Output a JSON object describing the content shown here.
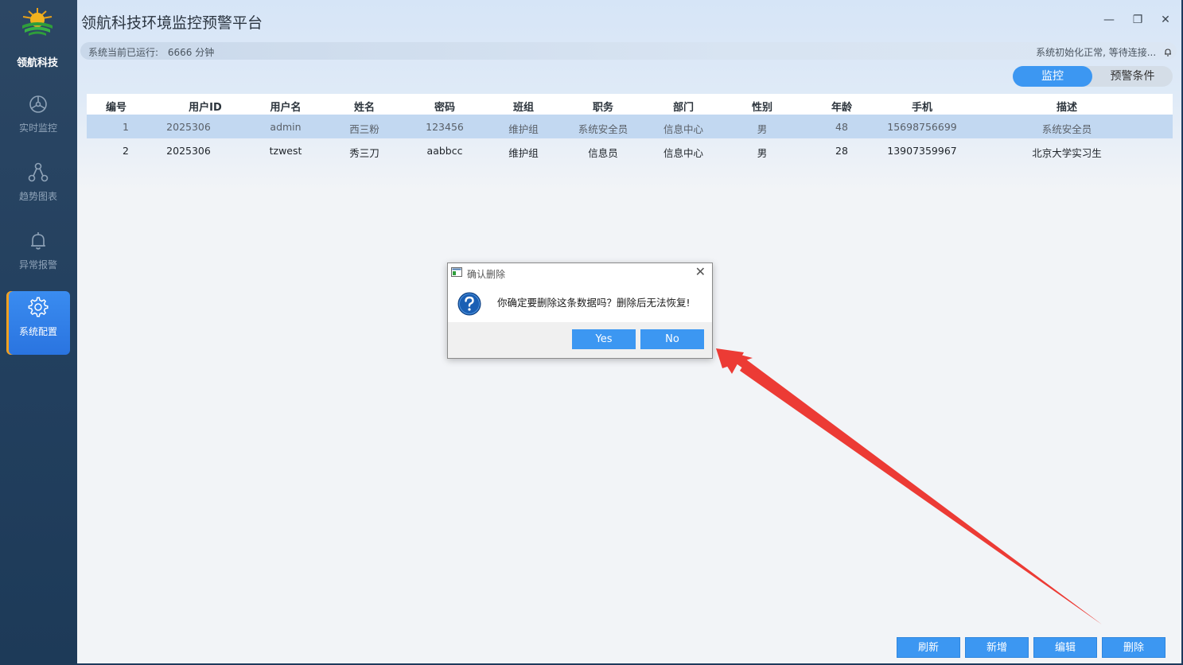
{
  "sidebar": {
    "brand": "领航科技",
    "items": [
      {
        "label": "实时监控",
        "icon": "monitor-icon",
        "active": false
      },
      {
        "label": "趋势图表",
        "icon": "share-icon",
        "active": false
      },
      {
        "label": "异常报警",
        "icon": "bell-icon",
        "active": false
      },
      {
        "label": "系统配置",
        "icon": "gear-icon",
        "active": true
      }
    ]
  },
  "header": {
    "title": "领航科技环境监控预警平台",
    "window_controls": {
      "minimize": "—",
      "restore": "❐",
      "close": "✕"
    }
  },
  "status": {
    "runtime_label": "系统当前已运行:",
    "runtime_value": "6666 分钟",
    "connection": "系统初始化正常, 等待连接..."
  },
  "tabs": [
    {
      "label": "监控",
      "active": true
    },
    {
      "label": "预警条件",
      "active": false
    }
  ],
  "table": {
    "columns": [
      "编号",
      "用户ID",
      "用户名",
      "姓名",
      "密码",
      "班组",
      "职务",
      "部门",
      "性别",
      "年龄",
      "手机",
      "描述"
    ],
    "rows": [
      [
        "1",
        "2025306",
        "admin",
        "西三粉",
        "123456",
        "维护组",
        "系统安全员",
        "信息中心",
        "男",
        "48",
        "15698756699",
        "系统安全员"
      ],
      [
        "2",
        "2025306",
        "tzwest",
        "秀三刀",
        "aabbcc",
        "维护组",
        "信息员",
        "信息中心",
        "男",
        "28",
        "13907359967",
        "北京大学实习生"
      ]
    ]
  },
  "actions": {
    "refresh": "刷新",
    "add": "新增",
    "edit": "编辑",
    "delete": "删除"
  },
  "dialog": {
    "title": "确认删除",
    "message": "你确定要删除这条数据吗？删除后无法恢复!",
    "yes": "Yes",
    "no": "No",
    "close": "✕"
  },
  "colors": {
    "accent": "#3c97f2",
    "sidebar": "#23405f",
    "selected_row": "#c2d8f1",
    "annotation_arrow": "#ec3b35"
  }
}
